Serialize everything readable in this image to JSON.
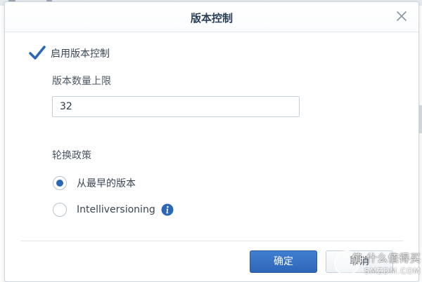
{
  "dialog": {
    "title": "版本控制",
    "enable_checkbox": {
      "label": "启用版本控制",
      "checked": true
    },
    "version_limit": {
      "label": "版本数量上限",
      "value": "32"
    },
    "rotation_policy": {
      "label": "轮换政策",
      "options": [
        {
          "label": "从最早的版本",
          "selected": true
        },
        {
          "label": "Intelliversioning",
          "selected": false,
          "has_info_icon": true
        }
      ]
    },
    "buttons": {
      "ok_label": "确定",
      "cancel_label": "取消"
    }
  },
  "watermark": {
    "text": "值 什么值得买",
    "sub": "SMZDM.COM"
  },
  "colors": {
    "primary": "#2f66b9",
    "checkbox": "#2c67b6",
    "info": "#2c67b6",
    "title": "#2a3f57"
  },
  "icons": {
    "close": "close-icon",
    "checkmark": "checkmark-icon",
    "info": "info-icon"
  }
}
